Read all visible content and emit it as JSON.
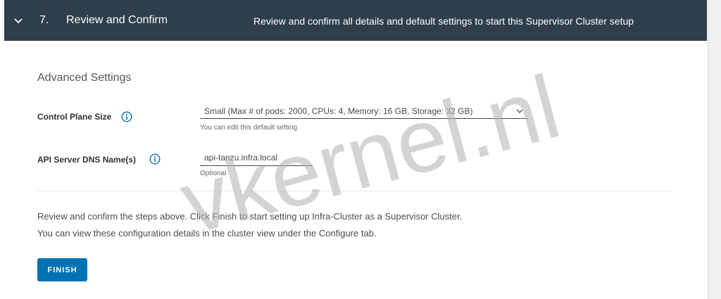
{
  "header": {
    "step_number": "7.",
    "step_title": "Review and Confirm",
    "step_description": "Review and confirm all details and default settings to start this Supervisor Cluster setup",
    "background": "#2e3e4a"
  },
  "advanced_settings": {
    "title": "Advanced Settings",
    "control_plane": {
      "label": "Control Plane Size",
      "value": "Small (Max # of pods: 2000, CPUs: 4, Memory: 16 GB, Storage: 32 GB)",
      "helper": "You can edit this default setting"
    },
    "api_dns": {
      "label": "API Server DNS Name(s)",
      "value": "api-tanzu.infra.local",
      "helper": "Optional"
    }
  },
  "review": {
    "line1": "Review and confirm the steps above. Click Finish to start setting up Infra-Cluster as a Supervisor Cluster.",
    "line2": "You can view these configuration details in the cluster view under the Configure tab."
  },
  "finish_button": {
    "label": "FINISH",
    "color": "#0072b2"
  },
  "watermark": {
    "text": "vkernel.nl"
  },
  "icons": {
    "collapse": "chevron-down-icon",
    "info": "info-icon",
    "dropdown": "caret-down-icon"
  }
}
